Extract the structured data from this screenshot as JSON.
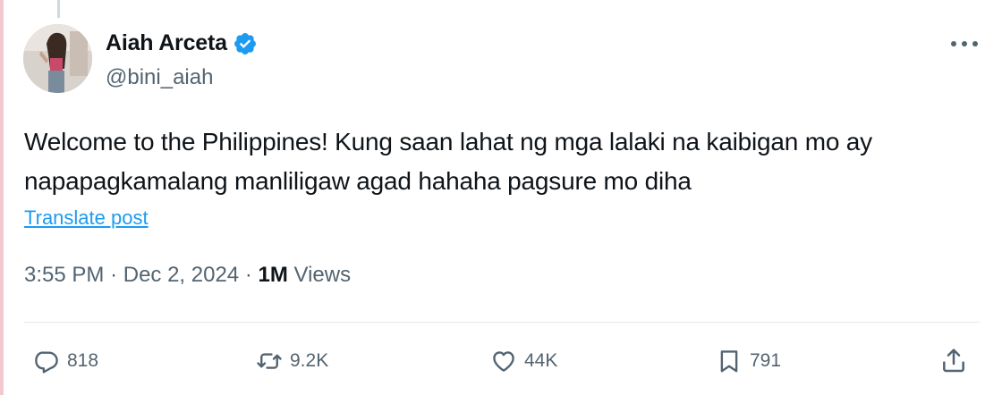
{
  "author": {
    "display_name": "Aiah Arceta",
    "handle": "@bini_aiah",
    "verified": true
  },
  "tweet": {
    "text": "Welcome to the Philippines! Kung saan lahat ng mga lalaki na kaibigan mo ay napapagkamalang manliligaw agad hahaha pagsure mo diha",
    "translate_label": "Translate post",
    "time": "3:55 PM",
    "separator": "·",
    "date": "Dec 2, 2024",
    "views_count": "1M",
    "views_label": "Views"
  },
  "actions": {
    "replies": "818",
    "reposts": "9.2K",
    "likes": "44K",
    "bookmarks": "791"
  },
  "colors": {
    "link": "#1d9bf0",
    "muted": "#536471",
    "text": "#0f1419",
    "verified": "#1d9bf0"
  },
  "icons": {
    "more": "more-horizontal-icon",
    "reply": "reply-icon",
    "repost": "repost-icon",
    "like": "heart-icon",
    "bookmark": "bookmark-icon",
    "share": "share-icon",
    "verified": "verified-badge-icon"
  }
}
